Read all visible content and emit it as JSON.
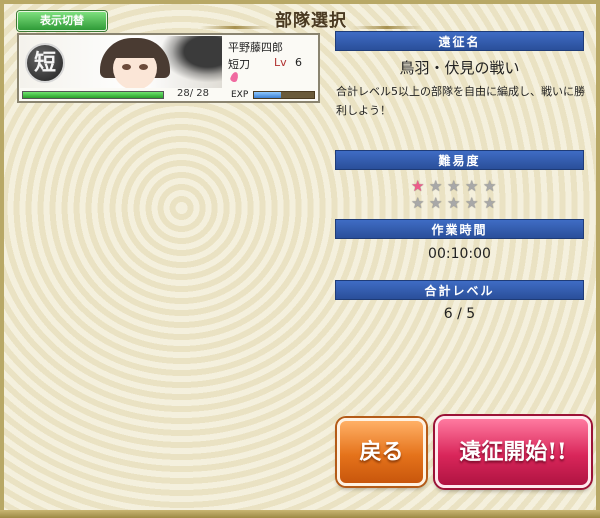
{
  "header": {
    "toggle_button": "表示切替",
    "title": "部隊選択"
  },
  "character": {
    "type_emblem": "短",
    "name": "平野藤四郎",
    "type": "短刀",
    "lv_label": "Lv",
    "level": "6",
    "hp_text": "28/ 28",
    "hp_fraction": 1.0,
    "exp_label": "EXP",
    "exp_fraction": 0.45,
    "status_icon": "sakura-petal-icon"
  },
  "expedition": {
    "name_header": "遠征名",
    "name": "鳥羽・伏見の戦い",
    "description": "合計レベル5以上の部隊を自由に編成し、戦いに勝利しよう！",
    "difficulty_header": "難易度",
    "difficulty_rows": [
      [
        "filled",
        "empty",
        "empty",
        "empty",
        "empty"
      ],
      [
        "empty",
        "empty",
        "empty",
        "empty",
        "empty"
      ]
    ],
    "time_header": "作業時間",
    "time": "00:10:00",
    "level_header": "合計レベル",
    "level_value": "6 / 5"
  },
  "buttons": {
    "back": "戻る",
    "start": "遠征開始!!"
  },
  "colors": {
    "section_header": "#2f5aae",
    "back_button": "#e5731b",
    "start_button": "#d9265a",
    "star_filled": "#ee5a8a",
    "star_empty": "#a8a8a8"
  }
}
